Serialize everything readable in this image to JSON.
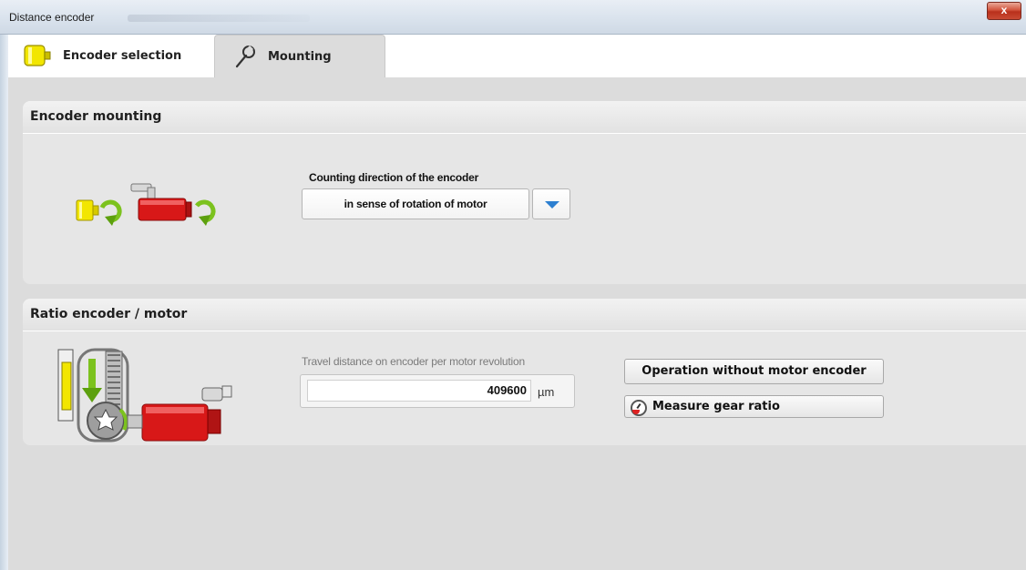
{
  "window": {
    "title": "Distance encoder",
    "close_label": "x"
  },
  "tabs": [
    {
      "label": "Encoder selection",
      "icon": "encoder-icon",
      "active": false
    },
    {
      "label": "Mounting",
      "icon": "wrench-icon",
      "active": true
    }
  ],
  "mounting": {
    "header": "Encoder mounting",
    "counting_label": "Counting direction of the encoder",
    "counting_value": "in sense of rotation of motor"
  },
  "ratio": {
    "header": "Ratio encoder / motor",
    "travel_label": "Travel distance on encoder per motor revolution",
    "travel_value": "409600",
    "travel_unit": "µm",
    "operation_button": "Operation without motor encoder",
    "measure_button": "Measure gear ratio"
  },
  "colors": {
    "encoder_yellow": "#f2e600",
    "motor_red": "#d81818",
    "arrow_green": "#7cc21e",
    "dropdown_arrow_blue": "#2c7fd0"
  }
}
